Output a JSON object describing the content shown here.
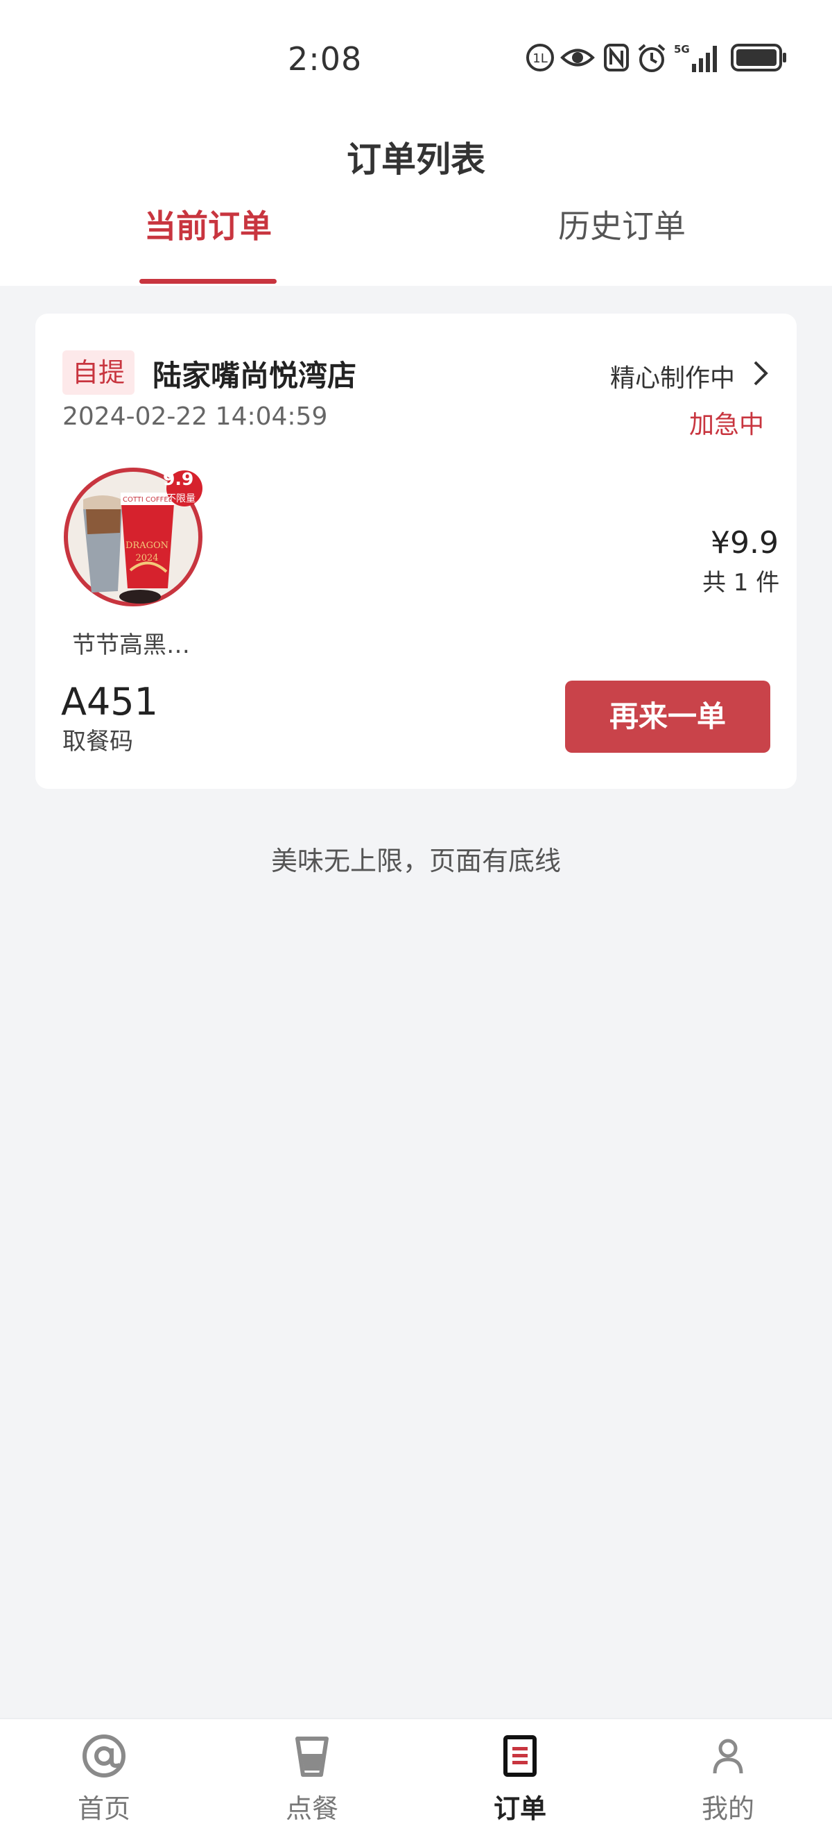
{
  "status_bar": {
    "time": "2:08"
  },
  "header": {
    "title": "订单列表",
    "tabs": [
      {
        "label": "当前订单",
        "active": true
      },
      {
        "label": "历史订单",
        "active": false
      }
    ]
  },
  "order": {
    "pickup_type": "自提",
    "store_name": "陆家嘴尚悦湾店",
    "time": "2024-02-22 14:04:59",
    "status": "精心制作中",
    "urgent": "加急中",
    "promo_badge": {
      "price": "9.9",
      "text": "不限量"
    },
    "product_name": "节节高黑…",
    "price": "¥9.9",
    "item_count": "共 1 件",
    "pickup_code": "A451",
    "pickup_code_label": "取餐码",
    "reorder_label": "再来一单"
  },
  "footer_note": "美味无上限，页面有底线",
  "bottom_nav": [
    {
      "label": "首页",
      "icon": "at-icon",
      "active": false
    },
    {
      "label": "点餐",
      "icon": "cup-icon",
      "active": false
    },
    {
      "label": "订单",
      "icon": "order-icon",
      "active": true
    },
    {
      "label": "我的",
      "icon": "user-icon",
      "active": false
    }
  ],
  "colors": {
    "accent": "#c8353f",
    "button": "#c9434a",
    "background": "#f3f4f6"
  }
}
